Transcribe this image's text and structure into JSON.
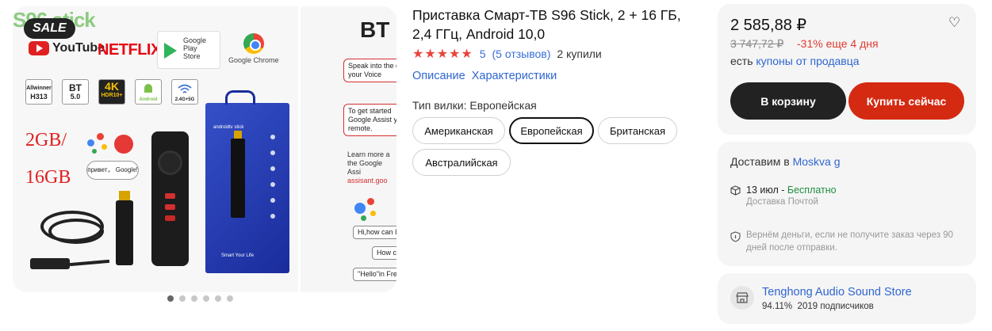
{
  "gallery": {
    "watermark": "S96 stick",
    "sale_badge": "SALE",
    "logos": {
      "youtube": "YouTube",
      "netflix": "NETFLIX",
      "google_play_line1": "Google Play",
      "google_play_line2": "Store",
      "chrome": "Google Chrome"
    },
    "specs": [
      {
        "line1": "Allwinner",
        "line2": "H313"
      },
      {
        "line1": "BT",
        "line2": "5.0"
      },
      {
        "line1": "4K",
        "line2": "HDR10+"
      },
      {
        "line1": "",
        "line2": "Android"
      },
      {
        "line1": "",
        "line2": "2.4G+5G"
      }
    ],
    "ram": "2GB/",
    "rom": "16GB",
    "voice_bubble": "привет， Google!",
    "box_brand": "androidtv stick",
    "box_tagline": "Smart Your Life",
    "slide2": {
      "title": "BT",
      "tip1": "Speak into the of your Voice",
      "tip2": "To get started Google Assist your remote.",
      "learn": "Learn more a the Google Assi",
      "learn_link": "assisant.goo",
      "chat1": "Hi,how can I",
      "chat2": "How co",
      "chat3": "\"Hello\"in Fre"
    },
    "dot_count": 6,
    "active_dot": 0
  },
  "product": {
    "title": "Приставка Смарт-ТВ S96 Stick, 2 + 16 ГБ, 2,4 ГГц, Android 10,0",
    "stars": "★★★★★",
    "rating": "5",
    "reviews": "(5 отзывов)",
    "purchases": "2 купили",
    "links": [
      "Описание",
      "Характеристики"
    ],
    "plug_label": "Тип вилки: Европейская",
    "plug_options": [
      {
        "label": "Американская",
        "selected": false
      },
      {
        "label": "Европейская",
        "selected": true
      },
      {
        "label": "Британская",
        "selected": false
      },
      {
        "label": "Австралийская",
        "selected": false
      }
    ]
  },
  "purchase": {
    "price": "2 585,88 ₽",
    "old_price": "3 747,72 ₽",
    "discount": "-31% еще 4 дня",
    "coupon_prefix": "есть ",
    "coupon_link": "купоны от продавца",
    "cart_button": "В корзину",
    "buy_button": "Купить сейчас"
  },
  "delivery": {
    "title_prefix": "Доставим в ",
    "city": "Moskva g",
    "date": "13 июл",
    "separator": " - ",
    "free": "Бесплатно",
    "method": "Доставка Почтой",
    "return_text": "Вернём деньги, если не получите заказ через 90 дней после отправки."
  },
  "store": {
    "name": "Tenghong Audio Sound Store",
    "rating": "94.11%",
    "subscribers": "2019 подписчиков"
  },
  "colors": {
    "accent_red": "#d42a12",
    "link_blue": "#2f66d0",
    "star_red": "#e8453c",
    "free_green": "#1e8e3e"
  }
}
